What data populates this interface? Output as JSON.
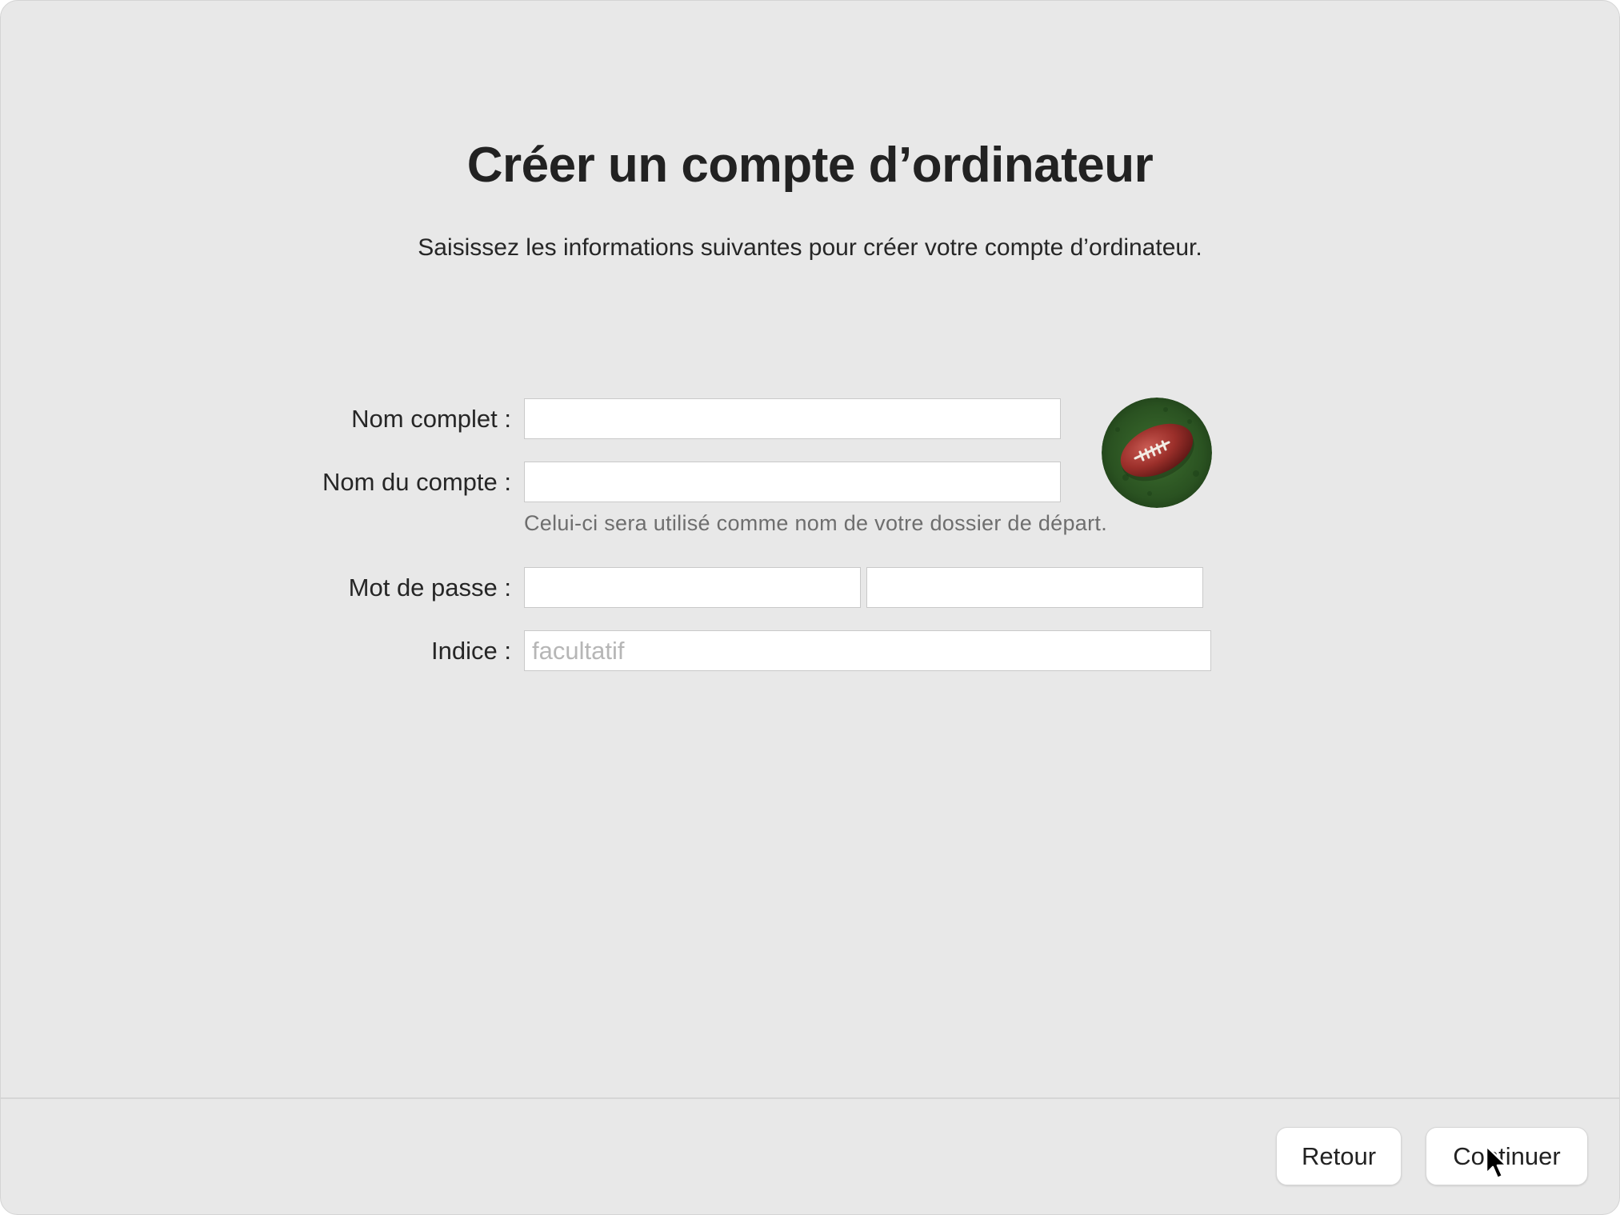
{
  "page": {
    "title": "Créer un compte d’ordinateur",
    "subtitle": "Saisissez les informations suivantes pour créer votre compte d’ordinateur."
  },
  "form": {
    "full_name": {
      "label": "Nom complet :",
      "value": ""
    },
    "account_name": {
      "label": "Nom du compte :",
      "value": "",
      "hint": "Celui-ci sera utilisé comme nom de votre dossier de départ."
    },
    "password": {
      "label": "Mot de passe :",
      "value": "",
      "verify_value": ""
    },
    "hint_field": {
      "label": "Indice :",
      "value": "",
      "placeholder": "facultatif"
    }
  },
  "avatar": {
    "icon": "football-icon"
  },
  "footer": {
    "back_label": "Retour",
    "continue_label": "Continuer"
  },
  "colors": {
    "background": "#e8e8e8",
    "text": "#222222",
    "hint_text": "#6e6e6e",
    "football": "#8e2a26",
    "grass": "#2f5a25"
  }
}
